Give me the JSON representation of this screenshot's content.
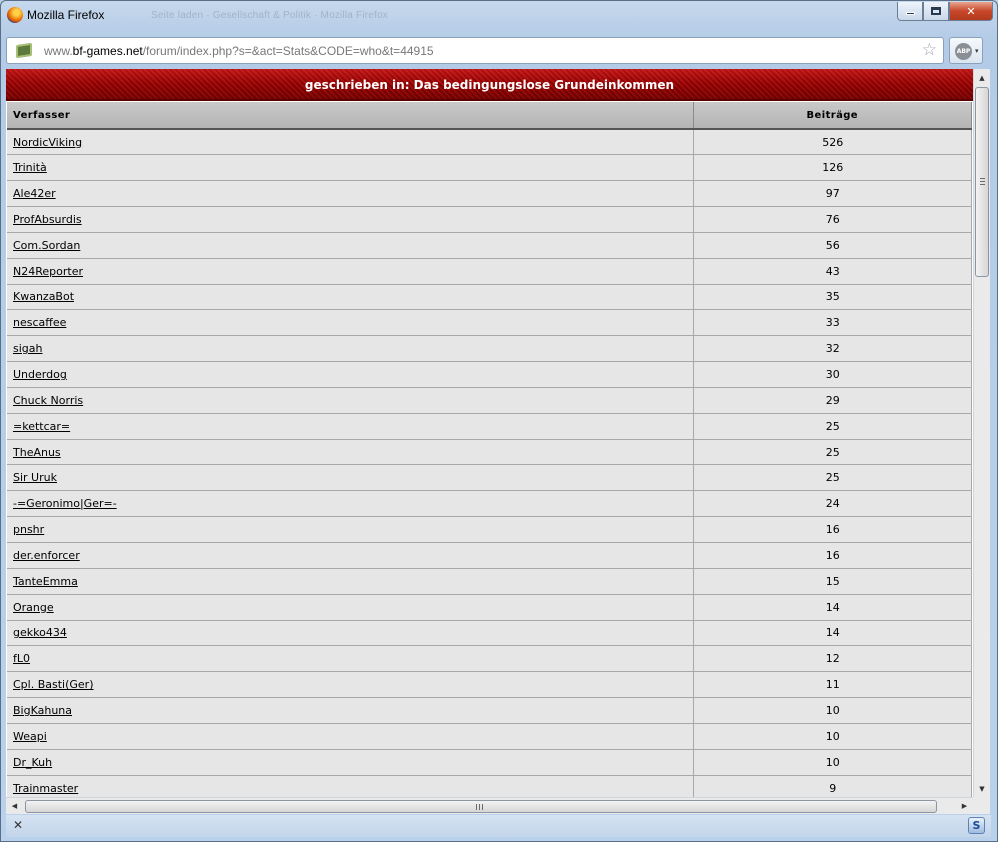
{
  "window": {
    "title": "Mozilla Firefox",
    "background_title": "Seite laden · Gesellschaft & Politik · Mozilla Firefox",
    "minimize_label": "",
    "maximize_label": "",
    "close_label": "✕"
  },
  "urlbar": {
    "url_prefix": "www.",
    "url_domain": "bf-games.net",
    "url_path": "/forum/index.php?s=&act=Stats&CODE=who&t=44915",
    "star_icon": "☆"
  },
  "addon": {
    "abp_label": "ABP",
    "dropdown": "▾"
  },
  "page": {
    "heading": "geschrieben in: Das bedingungslose Grundeinkommen",
    "columns": {
      "author": "Verfasser",
      "posts": "Beiträge"
    },
    "rows": [
      {
        "name": "NordicViking",
        "posts": "526"
      },
      {
        "name": "Trinità",
        "posts": "126"
      },
      {
        "name": "Ale42er",
        "posts": "97"
      },
      {
        "name": "ProfAbsurdis",
        "posts": "76"
      },
      {
        "name": "Com.Sordan",
        "posts": "56"
      },
      {
        "name": "N24Reporter",
        "posts": "43"
      },
      {
        "name": "KwanzaBot",
        "posts": "35"
      },
      {
        "name": "nescaffee",
        "posts": "33"
      },
      {
        "name": "sigah",
        "posts": "32"
      },
      {
        "name": "Underdog",
        "posts": "30"
      },
      {
        "name": "Chuck Norris",
        "posts": "29"
      },
      {
        "name": "=kettcar=",
        "posts": "25"
      },
      {
        "name": "TheAnus",
        "posts": "25"
      },
      {
        "name": "Sir Uruk",
        "posts": "25"
      },
      {
        "name": "-=Geronimo|Ger=-",
        "posts": "24"
      },
      {
        "name": "pnshr",
        "posts": "16"
      },
      {
        "name": "der.enforcer",
        "posts": "16"
      },
      {
        "name": "TanteEmma",
        "posts": "15"
      },
      {
        "name": "Orange",
        "posts": "14"
      },
      {
        "name": "gekko434",
        "posts": "14"
      },
      {
        "name": "fL0",
        "posts": "12"
      },
      {
        "name": "Cpl. Basti(Ger)",
        "posts": "11"
      },
      {
        "name": "BigKahuna",
        "posts": "10"
      },
      {
        "name": "Weapi",
        "posts": "10"
      },
      {
        "name": "Dr_Kuh",
        "posts": "10"
      },
      {
        "name": "Trainmaster",
        "posts": "9"
      }
    ]
  },
  "scroll": {
    "up": "▲",
    "down": "▼",
    "left": "◀",
    "right": "▶"
  },
  "statusbar": {
    "close": "✕",
    "addon": "S"
  }
}
